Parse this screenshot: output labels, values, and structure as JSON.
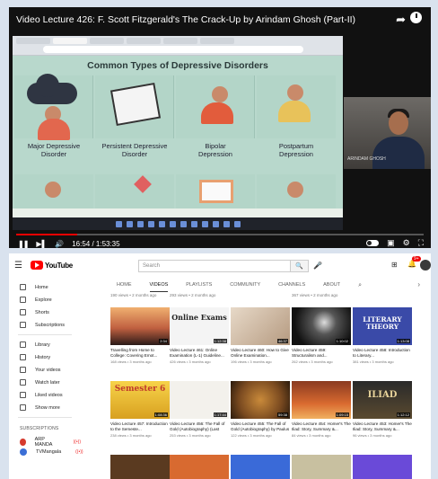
{
  "player": {
    "title": "Video Lecture 426: F. Scott Fitzgerald's The Crack-Up by Arindam Ghosh (Part-II)",
    "time": "16:54 / 1:53:35",
    "progress": 0.149,
    "slide": {
      "title": "Common Types of Depressive Disorders",
      "panels": [
        {
          "label": "Major Depressive\nDisorder"
        },
        {
          "label": "Persistent Depressive\nDisorder"
        },
        {
          "label": "Bipolar\nDepression"
        },
        {
          "label": "Postpartum\nDepression"
        }
      ]
    },
    "webcam_name": "ARINDAM GHOSH"
  },
  "youtube": {
    "logo_text": "YouTube",
    "search_placeholder": "Search",
    "notification_count": "9+",
    "sidebar": {
      "items": [
        {
          "label": "Home",
          "icon": "home-icon"
        },
        {
          "label": "Explore",
          "icon": "compass-icon"
        },
        {
          "label": "Shorts",
          "icon": "shorts-icon"
        },
        {
          "label": "Subscriptions",
          "icon": "subscriptions-icon"
        },
        {
          "label": "Library",
          "icon": "library-icon"
        },
        {
          "label": "History",
          "icon": "history-icon"
        },
        {
          "label": "Your videos",
          "icon": "your-videos-icon"
        },
        {
          "label": "Watch later",
          "icon": "clock-icon"
        },
        {
          "label": "Liked videos",
          "icon": "thumb-up-icon"
        },
        {
          "label": "Show more",
          "icon": "chevron-down-icon"
        }
      ],
      "subscriptions_heading": "SUBSCRIPTIONS",
      "subscriptions": [
        {
          "label": "ARP MANDA",
          "color": "#d63b2f"
        },
        {
          "label": "TVMangala",
          "color": "#3b6fd6"
        }
      ]
    },
    "tabs": [
      "HOME",
      "VIDEOS",
      "PLAYLISTS",
      "COMMUNITY",
      "CHANNELS",
      "ABOUT"
    ],
    "active_tab": "VIDEOS",
    "prev_row_meta": [
      "190 views • 2 months ago",
      "367 views • 2 months ago",
      "293 views • 2 months ago"
    ],
    "videos": [
      {
        "title": "Travelling from Home to College: Covering Emot...",
        "meta": "168 views • 3 months ago",
        "duration": "2:34",
        "thumb": "sunset"
      },
      {
        "title": "Video Lecture 461: Online Examination (L-1) Guideline...",
        "meta": "426 views • 3 months ago",
        "duration": "1:12:38",
        "thumb_text": "Online Exams",
        "thumb": "exams"
      },
      {
        "title": "Video Lecture 460: How to Give Online Examination...",
        "meta": "196 views • 3 months ago",
        "duration": "46:37",
        "thumb": "hands"
      },
      {
        "title": "Video Lecture 459: Structuralism and...",
        "meta": "262 views • 3 months ago",
        "duration": "1:10:02",
        "thumb": "dark"
      },
      {
        "title": "Video Lecture 458: Introduction to Literary...",
        "meta": "381 views • 3 months ago",
        "duration": "1:13:08",
        "thumb_text": "LITERARY THEORY",
        "thumb": "literary"
      },
      {
        "title": "Video Lecture 457: Introduction to the Semeste...",
        "meta": "238 views • 3 months ago",
        "duration": "1:08:36",
        "thumb_text": "Semester 6",
        "thumb": "semester"
      },
      {
        "title": "Video Lecture 456: The Fall of Gold (Autobiography) (Last Part)...",
        "meta": "253 views • 3 months ago",
        "duration": "1:17:44",
        "thumb": "book"
      },
      {
        "title": "Video Lecture 455: The Fall of Gold (Autobiography) by Paulus",
        "meta": "122 views • 3 months ago",
        "duration": "59:38",
        "thumb": "gold"
      },
      {
        "title": "Video Lecture 454: Homer's The Iliad: Story, Summary &...",
        "meta": "84 views • 3 months ago",
        "duration": "1:09:15",
        "thumb": "fire"
      },
      {
        "title": "Video Lecture 453: Homer's The Iliad: Story, Summary &...",
        "meta": "96 views • 3 months ago",
        "duration": "1:12:12",
        "thumb_text": "ILIAD",
        "thumb": "iliad"
      }
    ]
  }
}
